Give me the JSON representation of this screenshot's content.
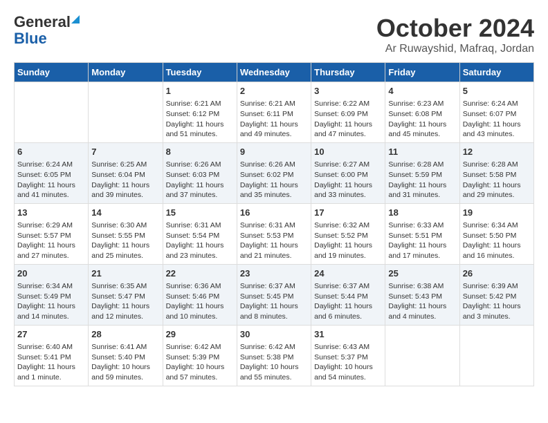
{
  "header": {
    "logo_line1": "General",
    "logo_line2": "Blue",
    "month_title": "October 2024",
    "location": "Ar Ruwayshid, Mafraq, Jordan"
  },
  "weekdays": [
    "Sunday",
    "Monday",
    "Tuesday",
    "Wednesday",
    "Thursday",
    "Friday",
    "Saturday"
  ],
  "weeks": [
    [
      {
        "day": "",
        "info": ""
      },
      {
        "day": "",
        "info": ""
      },
      {
        "day": "1",
        "info": "Sunrise: 6:21 AM\nSunset: 6:12 PM\nDaylight: 11 hours and 51 minutes."
      },
      {
        "day": "2",
        "info": "Sunrise: 6:21 AM\nSunset: 6:11 PM\nDaylight: 11 hours and 49 minutes."
      },
      {
        "day": "3",
        "info": "Sunrise: 6:22 AM\nSunset: 6:09 PM\nDaylight: 11 hours and 47 minutes."
      },
      {
        "day": "4",
        "info": "Sunrise: 6:23 AM\nSunset: 6:08 PM\nDaylight: 11 hours and 45 minutes."
      },
      {
        "day": "5",
        "info": "Sunrise: 6:24 AM\nSunset: 6:07 PM\nDaylight: 11 hours and 43 minutes."
      }
    ],
    [
      {
        "day": "6",
        "info": "Sunrise: 6:24 AM\nSunset: 6:05 PM\nDaylight: 11 hours and 41 minutes."
      },
      {
        "day": "7",
        "info": "Sunrise: 6:25 AM\nSunset: 6:04 PM\nDaylight: 11 hours and 39 minutes."
      },
      {
        "day": "8",
        "info": "Sunrise: 6:26 AM\nSunset: 6:03 PM\nDaylight: 11 hours and 37 minutes."
      },
      {
        "day": "9",
        "info": "Sunrise: 6:26 AM\nSunset: 6:02 PM\nDaylight: 11 hours and 35 minutes."
      },
      {
        "day": "10",
        "info": "Sunrise: 6:27 AM\nSunset: 6:00 PM\nDaylight: 11 hours and 33 minutes."
      },
      {
        "day": "11",
        "info": "Sunrise: 6:28 AM\nSunset: 5:59 PM\nDaylight: 11 hours and 31 minutes."
      },
      {
        "day": "12",
        "info": "Sunrise: 6:28 AM\nSunset: 5:58 PM\nDaylight: 11 hours and 29 minutes."
      }
    ],
    [
      {
        "day": "13",
        "info": "Sunrise: 6:29 AM\nSunset: 5:57 PM\nDaylight: 11 hours and 27 minutes."
      },
      {
        "day": "14",
        "info": "Sunrise: 6:30 AM\nSunset: 5:55 PM\nDaylight: 11 hours and 25 minutes."
      },
      {
        "day": "15",
        "info": "Sunrise: 6:31 AM\nSunset: 5:54 PM\nDaylight: 11 hours and 23 minutes."
      },
      {
        "day": "16",
        "info": "Sunrise: 6:31 AM\nSunset: 5:53 PM\nDaylight: 11 hours and 21 minutes."
      },
      {
        "day": "17",
        "info": "Sunrise: 6:32 AM\nSunset: 5:52 PM\nDaylight: 11 hours and 19 minutes."
      },
      {
        "day": "18",
        "info": "Sunrise: 6:33 AM\nSunset: 5:51 PM\nDaylight: 11 hours and 17 minutes."
      },
      {
        "day": "19",
        "info": "Sunrise: 6:34 AM\nSunset: 5:50 PM\nDaylight: 11 hours and 16 minutes."
      }
    ],
    [
      {
        "day": "20",
        "info": "Sunrise: 6:34 AM\nSunset: 5:49 PM\nDaylight: 11 hours and 14 minutes."
      },
      {
        "day": "21",
        "info": "Sunrise: 6:35 AM\nSunset: 5:47 PM\nDaylight: 11 hours and 12 minutes."
      },
      {
        "day": "22",
        "info": "Sunrise: 6:36 AM\nSunset: 5:46 PM\nDaylight: 11 hours and 10 minutes."
      },
      {
        "day": "23",
        "info": "Sunrise: 6:37 AM\nSunset: 5:45 PM\nDaylight: 11 hours and 8 minutes."
      },
      {
        "day": "24",
        "info": "Sunrise: 6:37 AM\nSunset: 5:44 PM\nDaylight: 11 hours and 6 minutes."
      },
      {
        "day": "25",
        "info": "Sunrise: 6:38 AM\nSunset: 5:43 PM\nDaylight: 11 hours and 4 minutes."
      },
      {
        "day": "26",
        "info": "Sunrise: 6:39 AM\nSunset: 5:42 PM\nDaylight: 11 hours and 3 minutes."
      }
    ],
    [
      {
        "day": "27",
        "info": "Sunrise: 6:40 AM\nSunset: 5:41 PM\nDaylight: 11 hours and 1 minute."
      },
      {
        "day": "28",
        "info": "Sunrise: 6:41 AM\nSunset: 5:40 PM\nDaylight: 10 hours and 59 minutes."
      },
      {
        "day": "29",
        "info": "Sunrise: 6:42 AM\nSunset: 5:39 PM\nDaylight: 10 hours and 57 minutes."
      },
      {
        "day": "30",
        "info": "Sunrise: 6:42 AM\nSunset: 5:38 PM\nDaylight: 10 hours and 55 minutes."
      },
      {
        "day": "31",
        "info": "Sunrise: 6:43 AM\nSunset: 5:37 PM\nDaylight: 10 hours and 54 minutes."
      },
      {
        "day": "",
        "info": ""
      },
      {
        "day": "",
        "info": ""
      }
    ]
  ]
}
